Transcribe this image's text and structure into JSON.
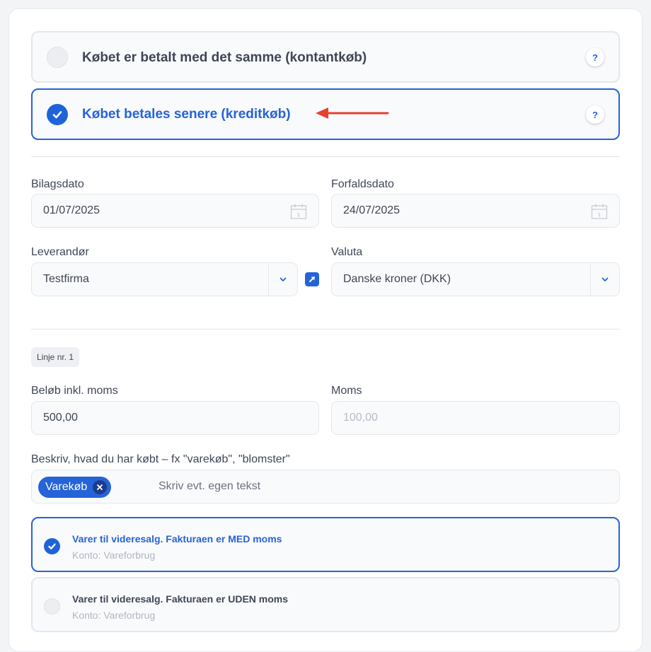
{
  "payment_options": [
    {
      "label": "Købet er betalt med det samme (kontantkøb)",
      "selected": false,
      "help": "?"
    },
    {
      "label": "Købet betales senere (kreditkøb)",
      "selected": true,
      "help": "?"
    }
  ],
  "annotation_color": "#e5412f",
  "fields": {
    "bilagsdato": {
      "label": "Bilagsdato",
      "value": "01/07/2025"
    },
    "forfaldsdato": {
      "label": "Forfaldsdato",
      "value": "24/07/2025"
    },
    "leverandor": {
      "label": "Leverandør",
      "value": "Testfirma"
    },
    "valuta": {
      "label": "Valuta",
      "value": "Danske kroner (DKK)"
    }
  },
  "line": {
    "badge": "Linje nr. 1",
    "amount": {
      "label": "Beløb inkl. moms",
      "value": "500,00"
    },
    "vat": {
      "label": "Moms",
      "value": "100,00"
    },
    "description": {
      "label": "Beskriv, hvad du har købt – fx \"varekøb\", \"blomster\"",
      "tag": "Varekøb",
      "placeholder": "Skriv evt. egen tekst"
    }
  },
  "accounts": [
    {
      "title": "Varer til videresalg. Fakturaen er MED moms",
      "subtitle": "Konto: Vareforbrug",
      "selected": true
    },
    {
      "title": "Varer til videresalg. Fakturaen er UDEN moms",
      "subtitle": "Konto: Vareforbrug",
      "selected": false
    }
  ],
  "colors": {
    "accent": "#2563d9",
    "border": "#e5e7eb",
    "field_bg": "#f9fafb"
  }
}
